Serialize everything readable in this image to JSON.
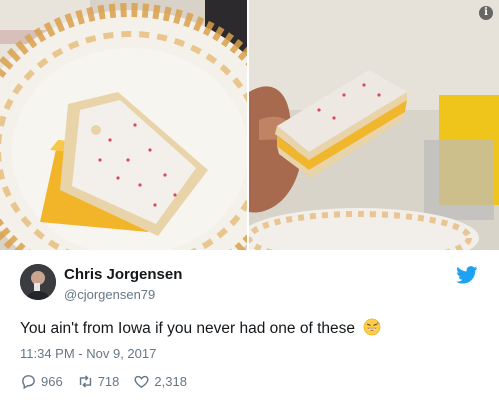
{
  "tweet": {
    "author_name": "Chris Jorgensen",
    "author_handle": "@cjorgensen79",
    "text": "You ain't from Iowa if you never had one of these",
    "emoji": "grinning-smile-sweat-emoji",
    "timestamp": "11:34 PM - Nov 9, 2017",
    "replies": "966",
    "retweets": "718",
    "likes": "2,318"
  },
  "media": {
    "info_glyph": "i"
  },
  "colors": {
    "text": "#14171a",
    "secondary": "#657786",
    "twitter_blue": "#1da1f2"
  },
  "icons": {
    "reply": "reply-icon",
    "retweet": "retweet-icon",
    "like": "heart-icon",
    "brand": "twitter-bird-icon",
    "info": "info-icon"
  }
}
